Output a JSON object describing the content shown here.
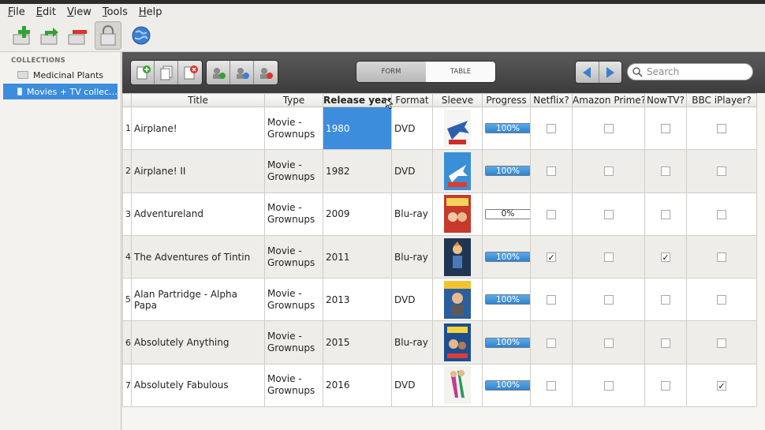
{
  "menu": [
    "File",
    "Edit",
    "View",
    "Tools",
    "Help"
  ],
  "sidebar": {
    "header": "COLLECTIONS",
    "items": [
      {
        "label": "Medicinal Plants",
        "selected": false
      },
      {
        "label": "Movies + TV collec…",
        "selected": true
      }
    ]
  },
  "view_toggle": {
    "form": "FORM",
    "table": "TABLE",
    "active": "TABLE"
  },
  "search": {
    "placeholder": "Search"
  },
  "table": {
    "columns": [
      "Title",
      "Type",
      "Release year",
      "Format",
      "Sleeve",
      "Progress",
      "Netflix?",
      "Amazon Prime?",
      "NowTV?",
      "BBC iPlayer?"
    ],
    "sorted_column": "Release year",
    "rows": [
      {
        "num": "1",
        "title": "Airplane!",
        "type": "Movie - Grownups",
        "year": "1980",
        "format": "DVD",
        "progress": "100%",
        "netflix": false,
        "amazon": false,
        "nowtv": false,
        "bbc": false,
        "sleeve": "sleeve-airplane-icon"
      },
      {
        "num": "2",
        "title": "Airplane! II",
        "type": "Movie - Grownups",
        "year": "1982",
        "format": "DVD",
        "progress": "100%",
        "netflix": false,
        "amazon": false,
        "nowtv": false,
        "bbc": false,
        "sleeve": "sleeve-airplane-2-icon"
      },
      {
        "num": "3",
        "title": "Adventureland",
        "type": "Movie - Grownups",
        "year": "2009",
        "format": "Blu-ray",
        "progress": "0%",
        "netflix": false,
        "amazon": false,
        "nowtv": false,
        "bbc": false,
        "sleeve": "sleeve-adventureland-icon"
      },
      {
        "num": "4",
        "title": "The Adventures of Tintin",
        "type": "Movie - Grownups",
        "year": "2011",
        "format": "Blu-ray",
        "progress": "100%",
        "netflix": true,
        "amazon": false,
        "nowtv": true,
        "bbc": false,
        "sleeve": "sleeve-tintin-icon"
      },
      {
        "num": "5",
        "title": "Alan Partridge - Alpha Papa",
        "type": "Movie - Grownups",
        "year": "2013",
        "format": "DVD",
        "progress": "100%",
        "netflix": false,
        "amazon": false,
        "nowtv": false,
        "bbc": false,
        "sleeve": "sleeve-alpha-papa-icon"
      },
      {
        "num": "6",
        "title": "Absolutely Anything",
        "type": "Movie - Grownups",
        "year": "2015",
        "format": "Blu-ray",
        "progress": "100%",
        "netflix": false,
        "amazon": false,
        "nowtv": false,
        "bbc": false,
        "sleeve": "sleeve-absolutely-anything-icon"
      },
      {
        "num": "7",
        "title": "Absolutely Fabulous",
        "type": "Movie - Grownups",
        "year": "2016",
        "format": "DVD",
        "progress": "100%",
        "netflix": false,
        "amazon": false,
        "nowtv": false,
        "bbc": true,
        "sleeve": "sleeve-absolutely-fabulous-icon"
      }
    ]
  },
  "colors": {
    "accent": "#3c8ddc",
    "toolbar_dark": "#3c3c3c",
    "progress_fill": "#2f83cf"
  }
}
